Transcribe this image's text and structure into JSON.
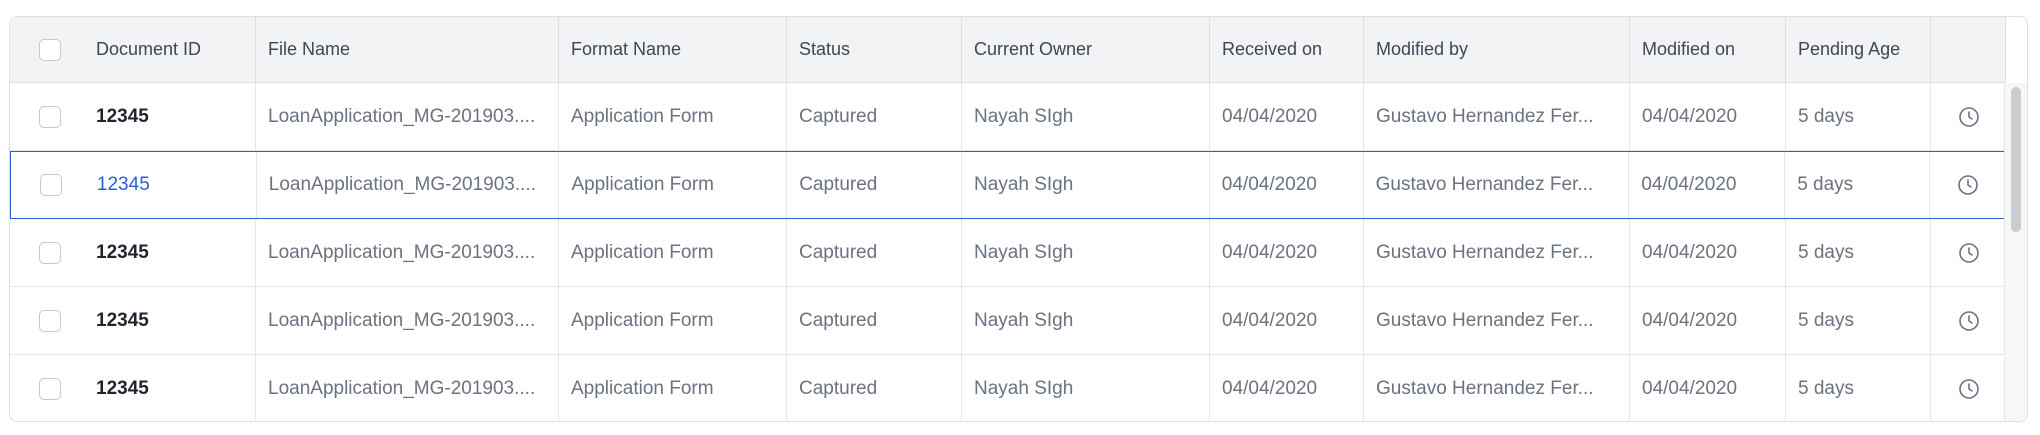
{
  "columns": {
    "document_id": "Document ID",
    "file_name": "File Name",
    "format_name": "Format Name",
    "status": "Status",
    "current_owner": "Current Owner",
    "received_on": "Received on",
    "modified_by": "Modified by",
    "modified_on": "Modified on",
    "pending_age": "Pending Age"
  },
  "rows": [
    {
      "document_id": "12345",
      "file_name": "LoanApplication_MG-201903....",
      "format_name": "Application Form",
      "status": "Captured",
      "current_owner": "Nayah SIgh",
      "received_on": "04/04/2020",
      "modified_by": "Gustavo Hernandez Fer...",
      "modified_on": "04/04/2020",
      "pending_age": "5 days",
      "icon": "clock-icon"
    },
    {
      "document_id": "12345",
      "file_name": "LoanApplication_MG-201903....",
      "format_name": "Application Form",
      "status": "Captured",
      "current_owner": "Nayah SIgh",
      "received_on": "04/04/2020",
      "modified_by": "Gustavo Hernandez Fer...",
      "modified_on": "04/04/2020",
      "pending_age": "5 days",
      "icon": "clock-icon"
    },
    {
      "document_id": "12345",
      "file_name": "LoanApplication_MG-201903....",
      "format_name": "Application Form",
      "status": "Captured",
      "current_owner": "Nayah SIgh",
      "received_on": "04/04/2020",
      "modified_by": "Gustavo Hernandez Fer...",
      "modified_on": "04/04/2020",
      "pending_age": "5 days",
      "icon": "clock-icon"
    },
    {
      "document_id": "12345",
      "file_name": "LoanApplication_MG-201903....",
      "format_name": "Application Form",
      "status": "Captured",
      "current_owner": "Nayah SIgh",
      "received_on": "04/04/2020",
      "modified_by": "Gustavo Hernandez Fer...",
      "modified_on": "04/04/2020",
      "pending_age": "5 days",
      "icon": "clock-icon"
    },
    {
      "document_id": "12345",
      "file_name": "LoanApplication_MG-201903....",
      "format_name": "Application Form",
      "status": "Captured",
      "current_owner": "Nayah SIgh",
      "received_on": "04/04/2020",
      "modified_by": "Gustavo Hernandez Fer...",
      "modified_on": "04/04/2020",
      "pending_age": "5 days",
      "icon": "clock-icon"
    }
  ],
  "selected_row": 1,
  "colors": {
    "accent": "#2b5fd9",
    "header_bg": "#f2f3f5",
    "border": "#dcdfe4"
  }
}
